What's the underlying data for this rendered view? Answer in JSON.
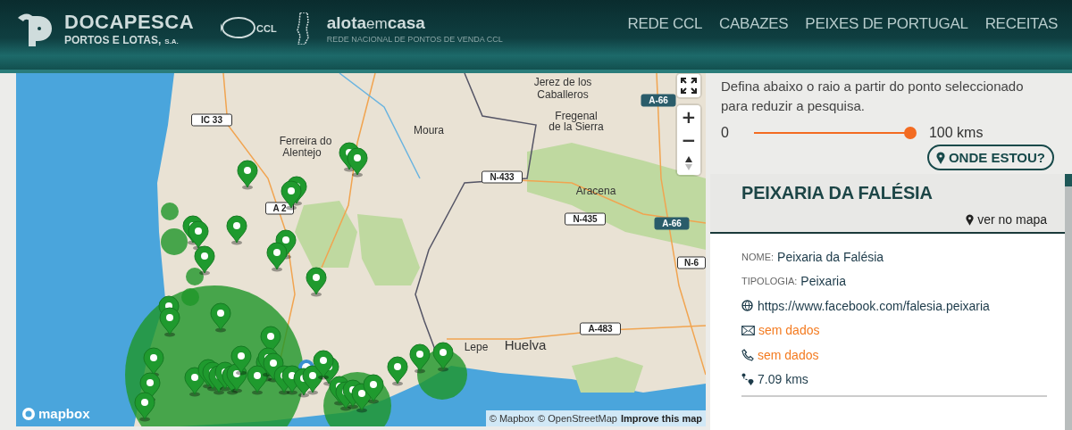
{
  "header": {
    "logo": {
      "name": "DOCAPESCA",
      "subtitle": "PORTOS E LOTAS,",
      "suffix": "S.A."
    },
    "ccl_logo": {
      "text": "CCL"
    },
    "lota_logo": {
      "word_1": "alota",
      "word_2": "em",
      "word_3": "casa",
      "tagline": "REDE NACIONAL DE PONTOS DE VENDA CCL"
    },
    "nav": [
      {
        "label": "REDE CCL"
      },
      {
        "label": "CABAZES"
      },
      {
        "label": "PEIXES DE PORTUGAL"
      },
      {
        "label": "RECEITAS"
      }
    ]
  },
  "map": {
    "labels": [
      {
        "kind": "city",
        "text": "Jerez de los"
      },
      {
        "kind": "city",
        "text": "Caballeros"
      },
      {
        "kind": "city",
        "text": "Fregenal"
      },
      {
        "kind": "city",
        "text": "de la Sierra"
      },
      {
        "kind": "city",
        "text": "Moura"
      },
      {
        "kind": "city",
        "text": "Ferreira do"
      },
      {
        "kind": "city",
        "text": "Alentejo"
      },
      {
        "kind": "city",
        "text": "Aracena"
      },
      {
        "kind": "city",
        "text": "Lepe"
      },
      {
        "kind": "city",
        "text": "Huelva"
      },
      {
        "kind": "road",
        "text": "IC 33"
      },
      {
        "kind": "road",
        "text": "A 2"
      },
      {
        "kind": "road",
        "text": "N-433"
      },
      {
        "kind": "road",
        "text": "N-435"
      },
      {
        "kind": "motorway",
        "text": "A-66"
      },
      {
        "kind": "motorway",
        "text": "A-66"
      },
      {
        "kind": "road",
        "text": "A-483"
      },
      {
        "kind": "road",
        "text": "N-6"
      }
    ],
    "zoom_in": "+",
    "zoom_out": "−",
    "brand": "mapbox",
    "attribution": [
      "© Mapbox",
      "© OpenStreetMap"
    ],
    "improve_link": "Improve this map"
  },
  "radius": {
    "instructions": "Defina abaixo o raio a partir do ponto seleccionado para reduzir a pesquisa.",
    "min": "0",
    "max": "100 kms",
    "level": 1.0
  },
  "locate_button": "ONDE ESTOU?",
  "result": {
    "title": "PEIXARIA DA FALÉSIA",
    "map_link": "ver no mapa",
    "details": [
      {
        "kind": "field",
        "label": "NOME:",
        "value": "Peixaria da Falésia"
      },
      {
        "kind": "field",
        "label": "TIPOLOGIA:",
        "value": "Peixaria"
      },
      {
        "kind": "website",
        "value": "https://www.facebook.com/falesia.peixaria",
        "missing": false
      },
      {
        "kind": "email",
        "value": "sem dados",
        "missing": true
      },
      {
        "kind": "phone",
        "value": "sem dados",
        "missing": true
      },
      {
        "kind": "distance",
        "value": "7.09 kms",
        "missing": false
      }
    ]
  }
}
